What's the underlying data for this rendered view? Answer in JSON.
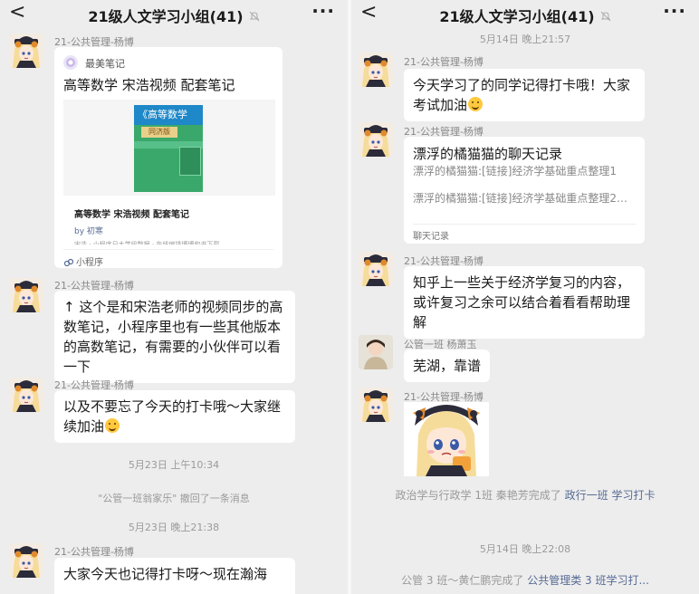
{
  "header": {
    "back_glyph": "<",
    "title": "21级人文学习小组(41)",
    "more_glyph": "···"
  },
  "left": {
    "sender": "21-公共管理-杨博",
    "miniprogram": {
      "source_name": "最美笔记",
      "title": "高等数学 宋浩视频 配套笔记",
      "book_title": "《高等数学",
      "book_edition": "同济版",
      "caption": "高等数学 宋浩视频 配套笔记",
      "author": "by 初寒",
      "faint_line": "宋浩 · 小程序日大学段数据 · 在线编排博博和书下载",
      "footer": "小程序"
    },
    "msg2": "↑ 这个是和宋浩老师的视频同步的高数笔记，小程序里也有一些其他版本的高数笔记，有需要的小伙伴可以看一下",
    "msg3": "以及不要忘了今天的打卡哦～大家继续加油",
    "time1": "5月23日 上午10:34",
    "recall": "\"公管一班翁家乐\" 撤回了一条消息",
    "time2": "5月23日 晚上21:38",
    "msg4": "大家今天也记得打卡呀～现在瀚海"
  },
  "right": {
    "time1": "5月14日 晚上21:57",
    "sender": "21-公共管理-杨博",
    "msg1": "今天学习了的同学记得打卡哦！大家考试加油",
    "chat_record": {
      "title": "漂浮的橘猫猫的聊天记录",
      "line1": "漂浮的橘猫猫:[链接]经济学基础重点整理1",
      "line2": "漂浮的橘猫猫:[链接]经济学基础重点整理2…",
      "footer": "聊天记录"
    },
    "msg3": "知乎上一些关于经济学复习的内容，或许复习之余可以结合着看看帮助理解",
    "sender2": "公管一班  杨萧玉",
    "msg4": "芜湖，靠谱",
    "checkin1_prefix": "政治学与行政学  1班  秦艳芳完成了",
    "checkin1_link": "政行一班 学习打卡",
    "time2": "5月14日 晚上22:08",
    "checkin2_prefix": "公管 3 班～黄仁鹏完成了",
    "checkin2_link": "公共管理类 3 班学习打..."
  },
  "colors": {
    "background": "#ededed",
    "bubble": "#ffffff",
    "link": "#576b95",
    "system_text": "#9a9a9a",
    "book_green": "#4caf79",
    "book_blue": "#1e88c8"
  },
  "icons": [
    "back-arrow-icon",
    "mute-bell-icon",
    "more-icon",
    "source-logo-icon",
    "miniprogram-icon",
    "smile-emoji-icon"
  ]
}
